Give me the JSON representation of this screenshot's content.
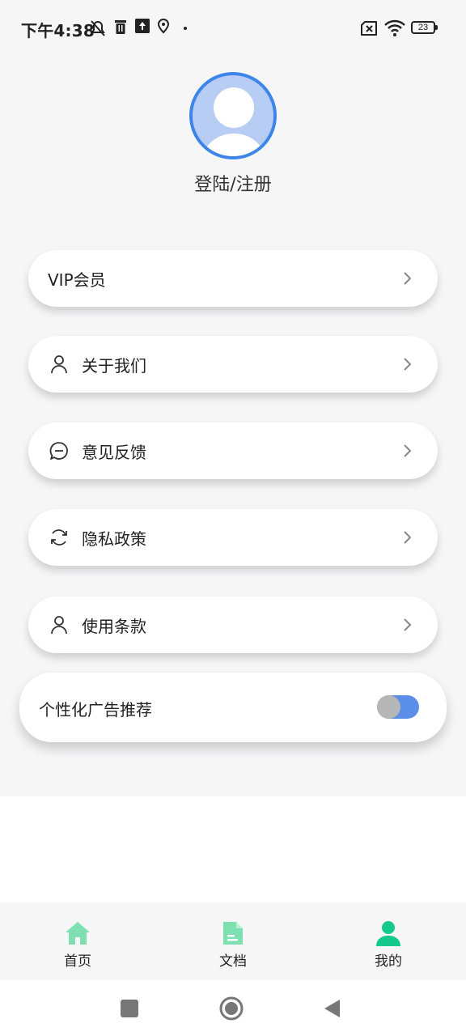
{
  "status_bar": {
    "time": "下午4:38",
    "battery": "23",
    "icons": [
      "mute-icon",
      "trash-icon",
      "upload-icon",
      "location-icon",
      "sim-error-icon",
      "wifi-icon",
      "battery-icon"
    ]
  },
  "profile": {
    "avatar_icon": "user-avatar-icon",
    "login_label": "登陆/注册"
  },
  "menu": {
    "items": [
      {
        "label": "VIP会员",
        "icon": null
      },
      {
        "label": "关于我们",
        "icon": "person-icon"
      },
      {
        "label": "意见反馈",
        "icon": "chat-icon"
      },
      {
        "label": "隐私政策",
        "icon": "refresh-icon"
      },
      {
        "label": "使用条款",
        "icon": "person-icon"
      }
    ]
  },
  "ad_setting": {
    "label": "个性化广告推荐",
    "enabled": true
  },
  "bottom_nav": {
    "items": [
      {
        "label": "首页",
        "icon": "home-icon"
      },
      {
        "label": "文档",
        "icon": "document-icon"
      },
      {
        "label": "我的",
        "icon": "profile-icon",
        "active": true
      }
    ]
  },
  "colors": {
    "accent": "#3d86e8",
    "nav_green": "#7ee0b0",
    "nav_active": "#14c98a",
    "toggle_on": "#5b8fe8"
  }
}
